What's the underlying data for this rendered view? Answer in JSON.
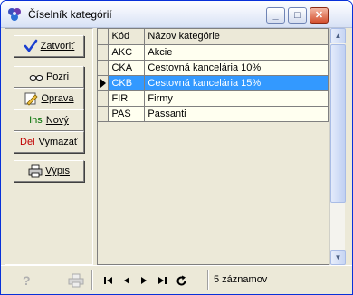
{
  "window": {
    "title": "Číselník kategórií",
    "controls": {
      "minimize": "_",
      "maximize": "□",
      "close": "✕"
    }
  },
  "toolbar": {
    "close_label": "Zatvoriť",
    "view_label": "Pozri",
    "edit_label": "Oprava",
    "new_key": "Ins",
    "new_label": "Nový",
    "delete_key": "Del",
    "delete_label": "Vymazať",
    "print_label": "Výpis"
  },
  "grid": {
    "columns": [
      "Kód",
      "Názov kategórie"
    ],
    "rows": [
      {
        "code": "AKC",
        "name": "Akcie"
      },
      {
        "code": "CKA",
        "name": "Cestovná kancelária 10%"
      },
      {
        "code": "CKB",
        "name": "Cestovná kancelária 15%"
      },
      {
        "code": "FIR",
        "name": "Firmy"
      },
      {
        "code": "PAS",
        "name": "Passanti"
      }
    ],
    "selected_index": 2
  },
  "statusbar": {
    "help": "?",
    "records": "5 záznamov"
  },
  "colors": {
    "selection": "#3399ff",
    "row_bg": "#fffff0",
    "face": "#ece9d8"
  }
}
